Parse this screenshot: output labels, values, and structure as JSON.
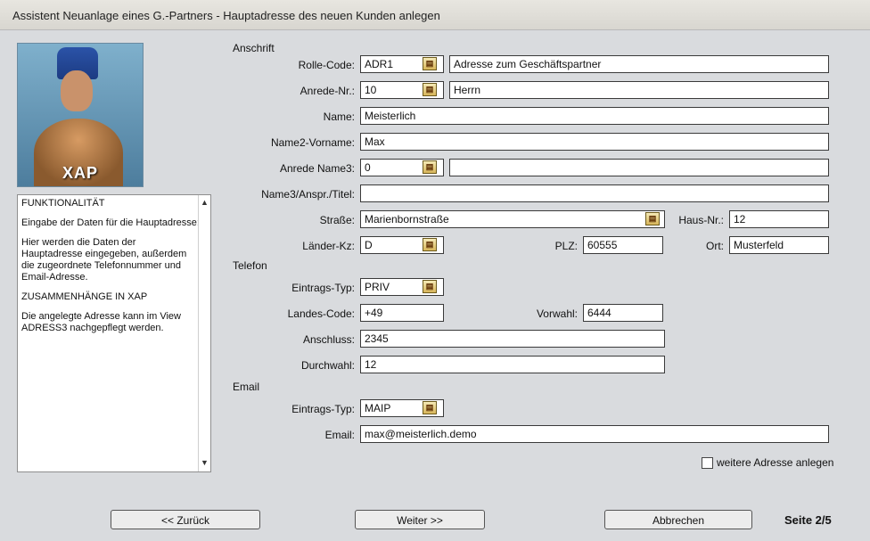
{
  "window": {
    "title": "Assistent Neuanlage eines G.-Partners - Hauptadresse des neuen Kunden anlegen"
  },
  "logo": {
    "text": "XAP"
  },
  "info": {
    "heading1": "FUNKTIONALITÄT",
    "para1": "Eingabe der Daten für die Hauptadresse:",
    "para2": "Hier werden die Daten der Hauptadresse eingegeben, außerdem die zugeordnete Telefonnummer und Email-Adresse.",
    "heading2": "ZUSAMMENHÄNGE IN XAP",
    "para3": "Die angelegte Adresse kann im View ADRESS3 nachgepflegt werden."
  },
  "anschrift": {
    "section": "Anschrift",
    "rolle_label": "Rolle-Code:",
    "rolle_code": "ADR1",
    "rolle_desc": "Adresse zum Geschäftspartner",
    "anrede_label": "Anrede-Nr.:",
    "anrede_nr": "10",
    "anrede_desc": "Herrn",
    "name_label": "Name:",
    "name": "Meisterlich",
    "vorname_label": "Name2-Vorname:",
    "vorname": "Max",
    "anrede3_label": "Anrede Name3:",
    "anrede3": "0",
    "anrede3_desc": "",
    "name3_label": "Name3/Anspr./Titel:",
    "name3": "",
    "strasse_label": "Straße:",
    "strasse": "Marienbornstraße",
    "hausnr_label": "Haus-Nr.:",
    "hausnr": "12",
    "land_label": "Länder-Kz:",
    "land": "D",
    "plz_label": "PLZ:",
    "plz": "60555",
    "ort_label": "Ort:",
    "ort": "Musterfeld"
  },
  "telefon": {
    "section": "Telefon",
    "typ_label": "Eintrags-Typ:",
    "typ": "PRIV",
    "landescode_label": "Landes-Code:",
    "landescode": "+49",
    "vorwahl_label": "Vorwahl:",
    "vorwahl": "6444",
    "anschluss_label": "Anschluss:",
    "anschluss": "2345",
    "durchwahl_label": "Durchwahl:",
    "durchwahl": "12"
  },
  "email": {
    "section": "Email",
    "typ_label": "Eintrags-Typ:",
    "typ": "MAIP",
    "email_label": "Email:",
    "email": "max@meisterlich.demo"
  },
  "weitere_label": "weitere Adresse anlegen",
  "buttons": {
    "back": "<< Zurück",
    "next": "Weiter >>",
    "cancel": "Abbrechen"
  },
  "page_indicator": "Seite 2/5",
  "icons": {
    "picker": "lookup-icon"
  }
}
